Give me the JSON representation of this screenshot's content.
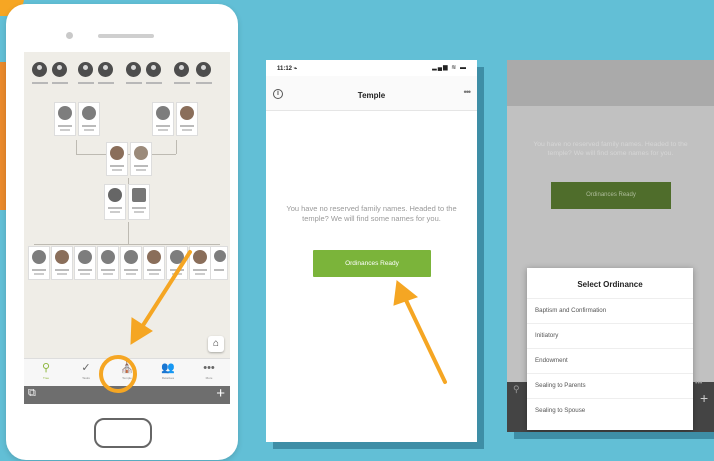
{
  "left_phone": {
    "tabs": [
      {
        "label": "Tree",
        "icon": "tree-icon",
        "active": true
      },
      {
        "label": "Tasks",
        "icon": "checkmark-icon",
        "active": false
      },
      {
        "label": "Temple",
        "icon": "temple-icon",
        "active": false
      },
      {
        "label": "Relatives",
        "icon": "people-icon",
        "active": false
      },
      {
        "label": "More",
        "icon": "more-icon",
        "active": false
      }
    ]
  },
  "temple_screen": {
    "status_time": "11:12 ⌁",
    "status_signal": "▂▄▆ ≋ ▬",
    "title": "Temple",
    "more": "•••",
    "message": "You have no reserved family names. Headed to the temple? We will find some names for you.",
    "button_label": "Ordinances Ready"
  },
  "select_screen": {
    "message": "You have no reserved family names. Headed to the temple? We will find some names for you.",
    "button_label": "Ordinances Ready",
    "sheet_title": "Select Ordinance",
    "options": [
      "Baptism and Confirmation",
      "Initiatory",
      "Endowment",
      "Sealing to Parents",
      "Sealing to Spouse"
    ]
  },
  "colors": {
    "background": "#62bfd6",
    "accent_orange": "#f5a623",
    "button_green": "#7bb43a",
    "shadow_blue": "#3e8ea6"
  }
}
